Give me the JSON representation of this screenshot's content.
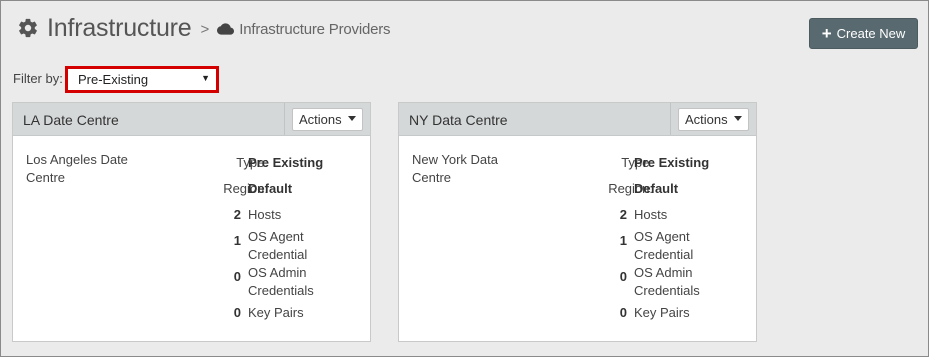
{
  "header": {
    "title": "Infrastructure",
    "separator": ">",
    "breadcrumb": "Infrastructure Providers"
  },
  "create_button": {
    "label": "Create New",
    "icon": "plus"
  },
  "filter": {
    "label": "Filter by:",
    "value": "Pre-Existing"
  },
  "cards": [
    {
      "title": "LA Date Centre",
      "actions_label": "Actions",
      "description": "Los Angeles Date Centre",
      "type_label": "Type:",
      "type_value": "Pre Existing",
      "region_label": "Region:",
      "region_value": "Default",
      "counts": [
        {
          "value": "2",
          "label": "Hosts"
        },
        {
          "value": "1",
          "label": "OS Agent Credential"
        },
        {
          "value": "0",
          "label": "OS Admin Credentials"
        },
        {
          "value": "0",
          "label": "Key Pairs"
        }
      ]
    },
    {
      "title": "NY Data Centre",
      "actions_label": "Actions",
      "description": "New York Data Centre",
      "type_label": "Type:",
      "type_value": "Pre Existing",
      "region_label": "Region:",
      "region_value": "Default",
      "counts": [
        {
          "value": "2",
          "label": "Hosts"
        },
        {
          "value": "1",
          "label": "OS Agent Credential"
        },
        {
          "value": "0",
          "label": "OS Admin Credentials"
        },
        {
          "value": "0",
          "label": "Key Pairs"
        }
      ]
    }
  ],
  "colors": {
    "background": "#ebebeb",
    "card_header": "#d5d8d9",
    "primary_button": "#586a70",
    "highlight_border": "#d40000"
  }
}
